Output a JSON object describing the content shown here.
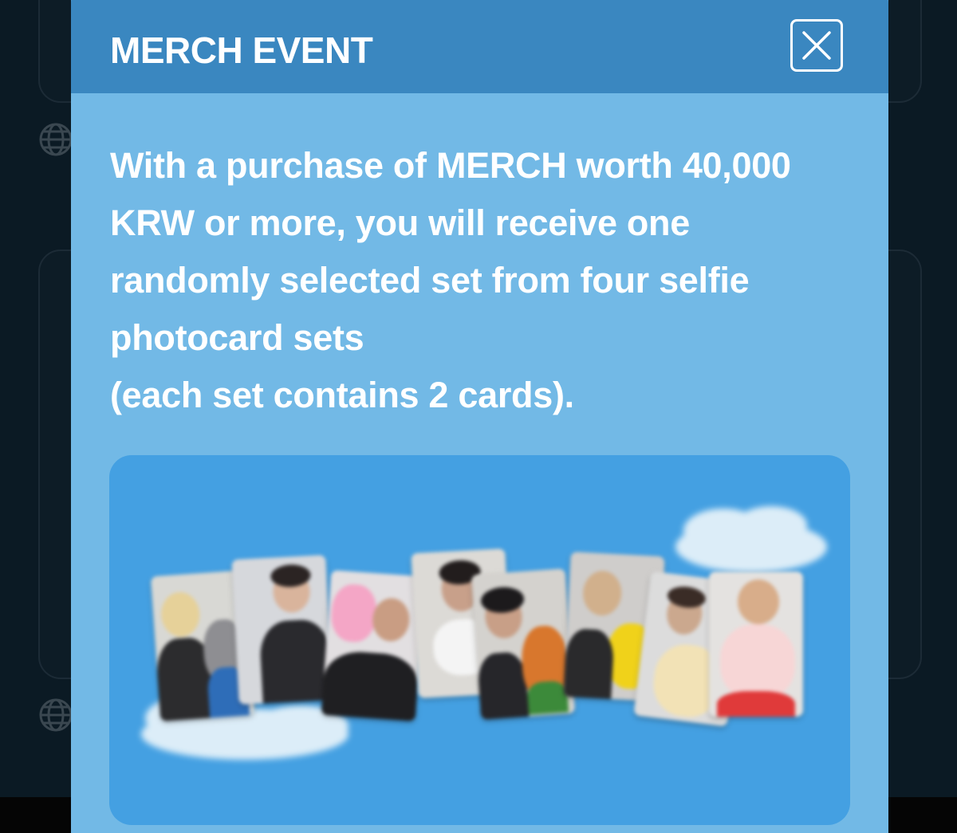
{
  "modal": {
    "title": "MERCH EVENT",
    "close_icon": "close-icon",
    "body_lines": [
      "With a purchase of MERCH worth 40,000",
      "KRW or more, you will receive one",
      "randomly selected set from four selfie",
      "photocard sets",
      "(each set contains 2 cards)."
    ]
  },
  "background": {
    "icons": [
      "globe-icon",
      "globe-icon"
    ]
  },
  "colors": {
    "header": "#3a87c0",
    "modal_bg": "#72b9e6",
    "banner_bg": "#44a0e2",
    "text": "#ffffff",
    "backdrop": "#0b1a24"
  },
  "banner": {
    "image": "photocards-on-clouds-illustration",
    "card_count": 8
  }
}
